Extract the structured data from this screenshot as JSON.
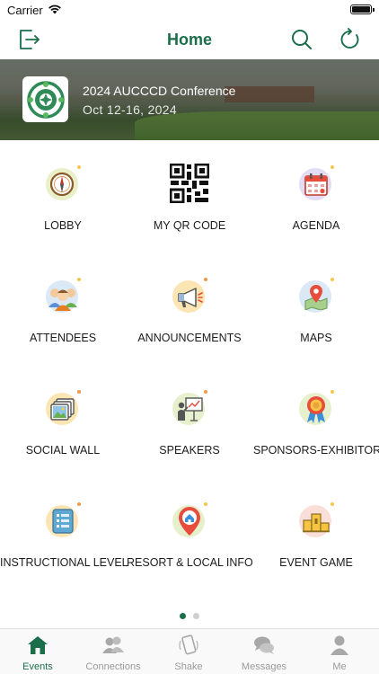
{
  "status_bar": {
    "carrier": "Carrier"
  },
  "nav": {
    "title": "Home"
  },
  "event": {
    "title": "2024 AUCCCD Conference",
    "dates": "Oct 12-16, 2024"
  },
  "grid": {
    "items": [
      {
        "label": "LOBBY",
        "icon": "compass-icon"
      },
      {
        "label": "MY QR CODE",
        "icon": "qr-code-icon"
      },
      {
        "label": "AGENDA",
        "icon": "calendar-icon"
      },
      {
        "label": "ATTENDEES",
        "icon": "people-icon"
      },
      {
        "label": "ANNOUNCEMENTS",
        "icon": "megaphone-icon"
      },
      {
        "label": "MAPS",
        "icon": "map-pin-icon"
      },
      {
        "label": "SOCIAL WALL",
        "icon": "photos-icon"
      },
      {
        "label": "SPEAKERS",
        "icon": "presenter-icon"
      },
      {
        "label": "SPONSORS-EXHIBITORS",
        "icon": "ribbon-badge-icon"
      },
      {
        "label": "INSTRUCTIONAL LEVEL",
        "icon": "checklist-icon"
      },
      {
        "label": "RESORT & LOCAL INFO",
        "icon": "home-pin-icon"
      },
      {
        "label": "EVENT GAME",
        "icon": "podium-icon"
      }
    ]
  },
  "pager": {
    "pages": 2,
    "current": 1
  },
  "tabs": [
    {
      "label": "Events",
      "icon": "home-icon",
      "active": true
    },
    {
      "label": "Connections",
      "icon": "connections-icon",
      "active": false
    },
    {
      "label": "Shake",
      "icon": "shake-phone-icon",
      "active": false
    },
    {
      "label": "Messages",
      "icon": "chat-bubbles-icon",
      "active": false
    },
    {
      "label": "Me",
      "icon": "person-icon",
      "active": false
    }
  ],
  "colors": {
    "accent": "#1b6e4a",
    "tab_inactive": "#9a9a9a"
  }
}
